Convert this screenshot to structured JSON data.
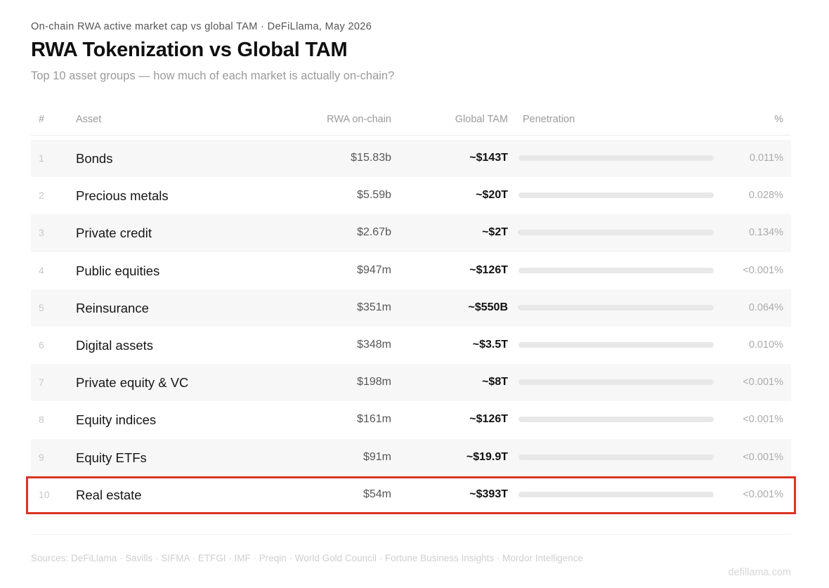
{
  "header": {
    "eyebrow": "On-chain RWA active market cap vs global TAM · DeFiLlama, May 2026",
    "title": "RWA Tokenization vs Global TAM",
    "subtitle": "Top 10 asset groups — how much of each market is actually on-chain?"
  },
  "table": {
    "columns": {
      "num": "#",
      "asset": "Asset",
      "rwa": "RWA on-chain",
      "tam": "Global TAM",
      "penetration": "Penetration",
      "pct": "%"
    },
    "rows": [
      {
        "num": "1",
        "asset": "Bonds",
        "rwa": "$15.83b",
        "tam": "~$143T",
        "pct": "0.011%",
        "penetration_fraction": 0.00011
      },
      {
        "num": "2",
        "asset": "Precious metals",
        "rwa": "$5.59b",
        "tam": "~$20T",
        "pct": "0.028%",
        "penetration_fraction": 0.00028
      },
      {
        "num": "3",
        "asset": "Private credit",
        "rwa": "$2.67b",
        "tam": "~$2T",
        "pct": "0.134%",
        "penetration_fraction": 0.00134
      },
      {
        "num": "4",
        "asset": "Public equities",
        "rwa": "$947m",
        "tam": "~$126T",
        "pct": "<0.001%",
        "penetration_fraction": 1e-05
      },
      {
        "num": "5",
        "asset": "Reinsurance",
        "rwa": "$351m",
        "tam": "~$550B",
        "pct": "0.064%",
        "penetration_fraction": 0.00064
      },
      {
        "num": "6",
        "asset": "Digital assets",
        "rwa": "$348m",
        "tam": "~$3.5T",
        "pct": "0.010%",
        "penetration_fraction": 0.0001
      },
      {
        "num": "7",
        "asset": "Private equity & VC",
        "rwa": "$198m",
        "tam": "~$8T",
        "pct": "<0.001%",
        "penetration_fraction": 1e-05
      },
      {
        "num": "8",
        "asset": "Equity indices",
        "rwa": "$161m",
        "tam": "~$126T",
        "pct": "<0.001%",
        "penetration_fraction": 1e-05
      },
      {
        "num": "9",
        "asset": "Equity ETFs",
        "rwa": "$91m",
        "tam": "~$19.9T",
        "pct": "<0.001%",
        "penetration_fraction": 1e-05
      },
      {
        "num": "10",
        "asset": "Real estate",
        "rwa": "$54m",
        "tam": "~$393T",
        "pct": "<0.001%",
        "penetration_fraction": 1e-05
      }
    ],
    "highlighted_row": "Real estate"
  },
  "footer": {
    "sources": "Sources: DeFiLlama · Savills · SIFMA · ETFGI · IMF · Preqin · World Gold Council · Fortune Business Insights · Mordor Intelligence",
    "brand": "defillama.com"
  },
  "colors": {
    "highlight_border": "#d93424",
    "row_shade": "#f7f7f7",
    "bar_track": "#e8e8e8"
  }
}
